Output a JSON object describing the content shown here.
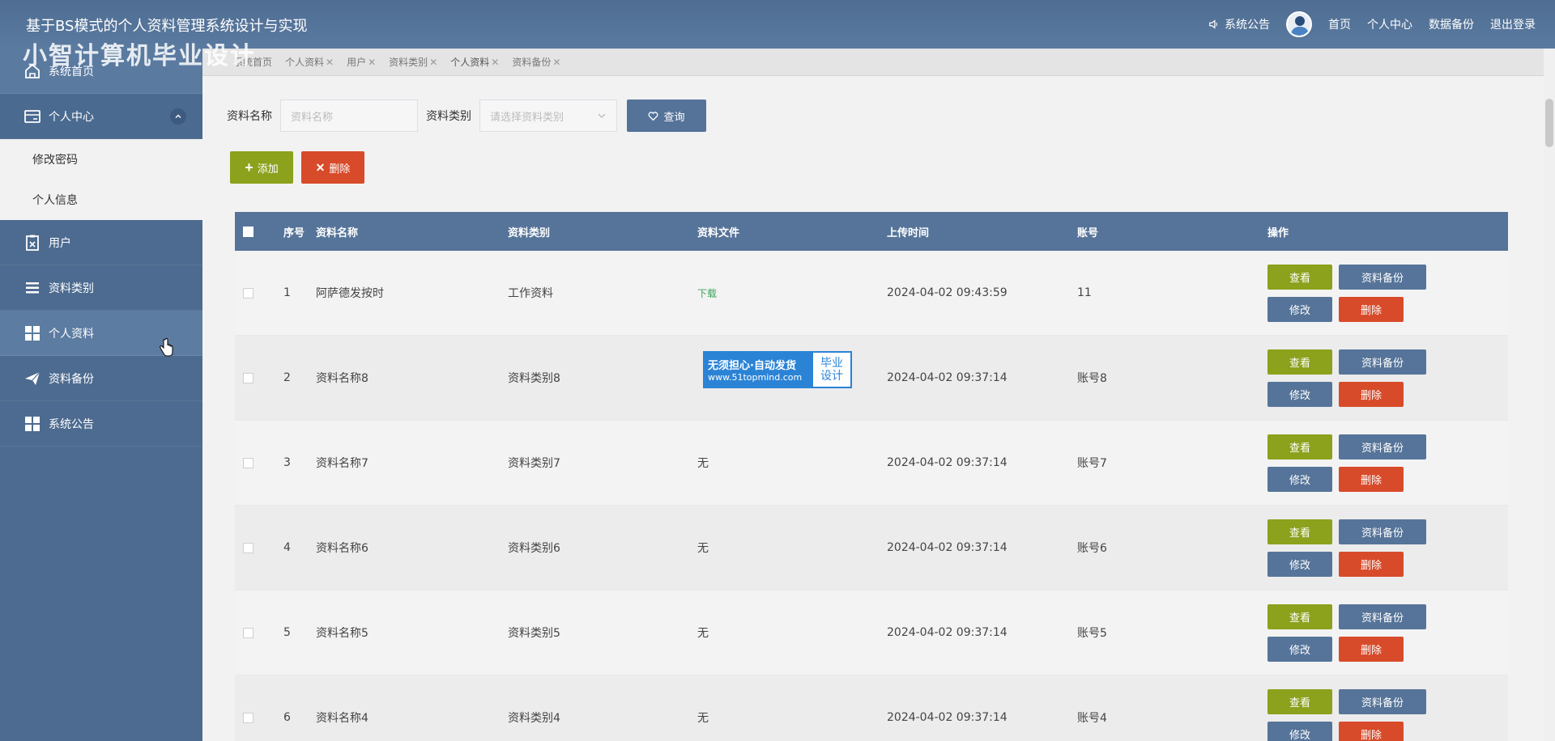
{
  "header": {
    "system_title": "基于BS模式的个人资料管理系统设计与实现",
    "watermark": "小智计算机毕业设计",
    "notice": "系统公告",
    "home": "首页",
    "center": "个人中心",
    "backup": "数据备份",
    "logout": "退出登录"
  },
  "sidebar": {
    "items": [
      {
        "label": "系统首页",
        "icon": "home-icon"
      },
      {
        "label": "个人中心",
        "icon": "card-icon"
      },
      {
        "label": "用户",
        "icon": "clipboard-icon"
      },
      {
        "label": "资料类别",
        "icon": "list-icon"
      },
      {
        "label": "个人资料",
        "icon": "grid-icon"
      },
      {
        "label": "资料备份",
        "icon": "paper-plane-icon"
      },
      {
        "label": "系统公告",
        "icon": "grid-icon"
      }
    ],
    "sub_items": [
      {
        "label": "修改密码"
      },
      {
        "label": "个人信息"
      }
    ]
  },
  "tabs": [
    {
      "label": "系统首页"
    },
    {
      "label": "个人资料"
    },
    {
      "label": "用户"
    },
    {
      "label": "资料类别"
    },
    {
      "label": "个人资料"
    },
    {
      "label": "资料备份"
    }
  ],
  "search": {
    "name_label": "资料名称",
    "name_placeholder": "资料名称",
    "type_label": "资料类别",
    "type_placeholder": "请选择资料类别",
    "query_label": "查询"
  },
  "actions": {
    "add_label": "添加",
    "delete_label": "删除"
  },
  "table": {
    "headers": [
      "序号",
      "资料名称",
      "资料类别",
      "资料文件",
      "上传时间",
      "账号",
      "操作"
    ],
    "rows": [
      {
        "idx": "1",
        "name": "阿萨德发按时",
        "type": "工作资料",
        "file": "下载",
        "time": "2024-04-02 09:43:59",
        "account": "11"
      },
      {
        "idx": "2",
        "name": "资料名称8",
        "type": "资料类别8",
        "file": "",
        "time": "2024-04-02 09:37:14",
        "account": "账号8"
      },
      {
        "idx": "3",
        "name": "资料名称7",
        "type": "资料类别7",
        "file": "无",
        "time": "2024-04-02 09:37:14",
        "account": "账号7"
      },
      {
        "idx": "4",
        "name": "资料名称6",
        "type": "资料类别6",
        "file": "无",
        "time": "2024-04-02 09:37:14",
        "account": "账号6"
      },
      {
        "idx": "5",
        "name": "资料名称5",
        "type": "资料类别5",
        "file": "无",
        "time": "2024-04-02 09:37:14",
        "account": "账号5"
      },
      {
        "idx": "6",
        "name": "资料名称4",
        "type": "资料类别4",
        "file": "无",
        "time": "2024-04-02 09:37:14",
        "account": "账号4"
      }
    ],
    "ops": {
      "view": "查看",
      "backup": "资料备份",
      "edit": "修改",
      "remove": "删除"
    }
  },
  "ad": {
    "line1": "无须担心·自动发货",
    "line2": "www.51topmind.com",
    "right1": "毕业",
    "right2": "设计"
  }
}
